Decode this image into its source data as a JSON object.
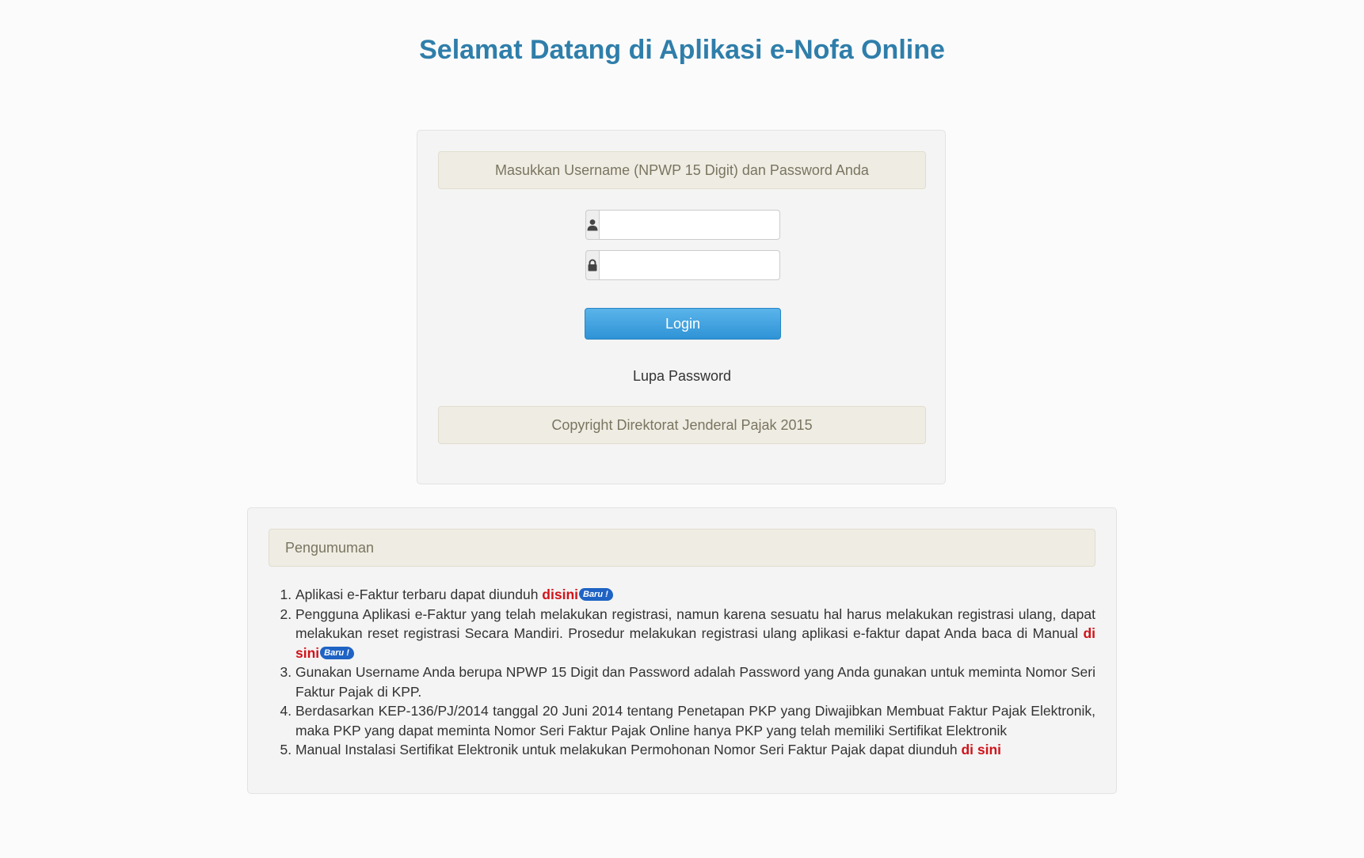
{
  "header": {
    "title": "Selamat Datang di Aplikasi e-Nofa Online"
  },
  "login": {
    "instruction": "Masukkan Username (NPWP 15 Digit) dan Password Anda",
    "username_icon": "user-icon",
    "password_icon": "lock-icon",
    "username_value": "",
    "password_value": "",
    "login_label": "Login",
    "forgot_label": "Lupa Password",
    "copyright": "Copyright Direktorat Jenderal Pajak 2015"
  },
  "announcement": {
    "title": "Pengumuman",
    "badge_label": "Baru !",
    "items": [
      {
        "text": "Aplikasi e-Faktur terbaru dapat diunduh ",
        "link": "disini"
      },
      {
        "text": "Pengguna Aplikasi e-Faktur yang telah melakukan registrasi, namun karena sesuatu hal harus melakukan registrasi ulang, dapat melakukan reset registrasi Secara Mandiri. Prosedur melakukan registrasi ulang aplikasi e-faktur dapat Anda baca di Manual ",
        "link": "di sini"
      },
      {
        "text": "Gunakan Username Anda berupa NPWP 15 Digit dan Password adalah Password yang Anda gunakan untuk meminta Nomor Seri Faktur Pajak di KPP."
      },
      {
        "text": "Berdasarkan KEP-136/PJ/2014 tanggal 20 Juni 2014 tentang Penetapan PKP yang Diwajibkan Membuat Faktur Pajak Elektronik, maka PKP yang dapat meminta Nomor Seri Faktur Pajak Online hanya PKP yang telah memiliki Sertifikat Elektronik"
      },
      {
        "text": "Manual Instalasi Sertifikat Elektronik untuk melakukan Permohonan Nomor Seri Faktur Pajak dapat diunduh ",
        "link": "di sini"
      }
    ]
  },
  "colors": {
    "title": "#2f7eaa",
    "login_button": "#3a9fe0",
    "link_red": "#d0141a",
    "badge_blue": "#1f63c4",
    "notice_background": "#efece3"
  }
}
